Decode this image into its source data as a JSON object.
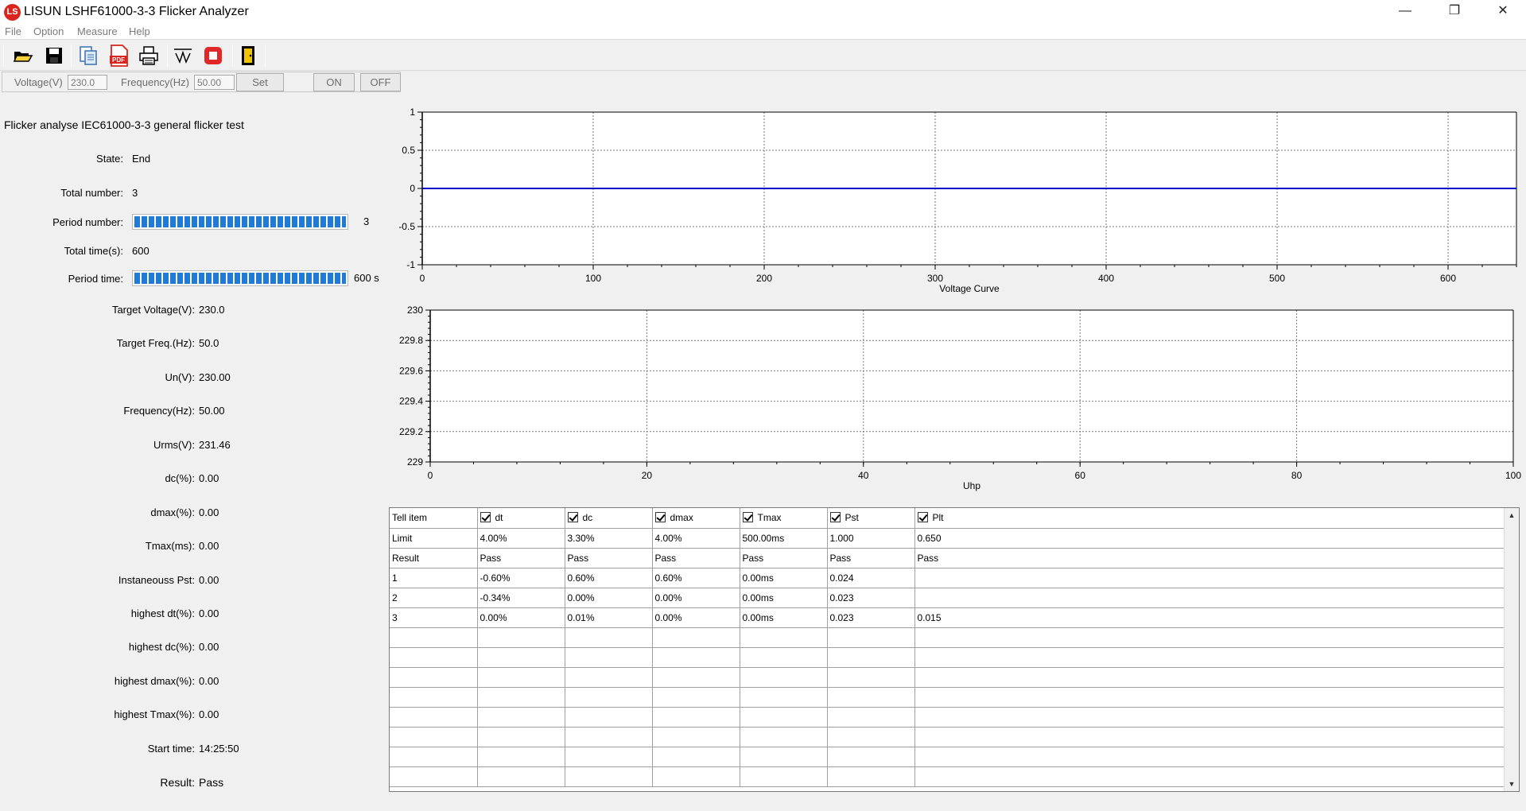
{
  "window": {
    "title": "LISUN LSHF61000-3-3 Flicker Analyzer",
    "logo_text": "LS",
    "minimize": "—",
    "restore": "❐",
    "close": "✕"
  },
  "menu": [
    "File",
    "Option",
    "Measure",
    "Help"
  ],
  "toolbar": {
    "icons": [
      "open-folder-icon",
      "save-disk-icon",
      "document-copy-icon",
      "pdf-export-icon",
      "print-icon",
      "waveform-icon",
      "stop-icon",
      "exit-door-icon"
    ],
    "pdf_label": "PDF"
  },
  "controls": {
    "voltage_label": "Voltage(V)",
    "voltage_value": "230.0",
    "frequency_label": "Frequency(Hz)",
    "frequency_value": "50.00",
    "set_label": "Set",
    "on_label": "ON",
    "off_label": "OFF"
  },
  "info": {
    "title": "Flicker analyse IEC61000-3-3 general flicker test",
    "state_label": "State:",
    "state_value": "End",
    "total_number_label": "Total number:",
    "total_number_value": "3",
    "period_number_label": "Period number:",
    "period_number_value": "3",
    "period_number_progress": 1.0,
    "total_time_label": "Total time(s):",
    "total_time_value": "600",
    "period_time_label": "Period time:",
    "period_time_value": "600 s",
    "period_time_progress": 1.0,
    "rows": [
      {
        "label": "Target Voltage(V):",
        "value": "230.0"
      },
      {
        "label": "Target Freq.(Hz):",
        "value": "50.0"
      },
      {
        "label": "Un(V):",
        "value": "230.00"
      },
      {
        "label": "Frequency(Hz):",
        "value": "50.00"
      },
      {
        "label": "Urms(V):",
        "value": "231.46"
      },
      {
        "label": "dc(%):",
        "value": "0.00"
      },
      {
        "label": "dmax(%):",
        "value": "0.00"
      },
      {
        "label": "Tmax(ms):",
        "value": "0.00"
      },
      {
        "label": "Instaneouss Pst:",
        "value": "0.00"
      },
      {
        "label": "highest dt(%):",
        "value": "0.00"
      },
      {
        "label": "highest dc(%):",
        "value": "0.00"
      },
      {
        "label": "highest dmax(%):",
        "value": "0.00"
      },
      {
        "label": "highest Tmax(%):",
        "value": "0.00"
      },
      {
        "label": "Start time:",
        "value": "14:25:50"
      },
      {
        "label": "Result:",
        "value": "Pass"
      }
    ]
  },
  "chart_data": [
    {
      "type": "line",
      "title": "",
      "xlabel": "Voltage Curve",
      "ylabel": "",
      "xlim": [
        0,
        640
      ],
      "ylim": [
        -1,
        1
      ],
      "xticks": [
        0,
        100,
        200,
        300,
        400,
        500,
        600
      ],
      "yticks": [
        1,
        0.5,
        0,
        -0.5,
        -1
      ],
      "ytick_labels": [
        "1",
        "0.5",
        "0",
        "-0.5",
        "-1"
      ],
      "grid": true,
      "series": [
        {
          "x": [
            0,
            640
          ],
          "y": [
            0,
            0
          ],
          "color": "#0000c8"
        }
      ]
    },
    {
      "type": "line",
      "title": "",
      "xlabel": "Uhp",
      "ylabel": "",
      "xlim": [
        0,
        100
      ],
      "ylim": [
        229,
        230
      ],
      "xticks": [
        0,
        20,
        40,
        60,
        80,
        100
      ],
      "yticks": [
        230,
        229.8,
        229.6,
        229.4,
        229.2,
        229
      ],
      "ytick_labels": [
        "230",
        "229.8",
        "229.6",
        "229.4",
        "229.2",
        "229"
      ],
      "grid": true,
      "series": []
    }
  ],
  "table": {
    "columns": [
      "Tell item",
      "dt",
      "dc",
      "dmax",
      "Tmax",
      "Pst",
      "Plt"
    ],
    "rows": [
      [
        "Limit",
        "4.00%",
        "3.30%",
        "4.00%",
        "500.00ms",
        "1.000",
        "0.650"
      ],
      [
        "Result",
        "Pass",
        "Pass",
        "Pass",
        "Pass",
        "Pass",
        "Pass"
      ],
      [
        "1",
        "-0.60%",
        "0.60%",
        "0.60%",
        "0.00ms",
        "0.024",
        ""
      ],
      [
        "2",
        "-0.34%",
        "0.00%",
        "0.00%",
        "0.00ms",
        "0.023",
        ""
      ],
      [
        "3",
        "0.00%",
        "0.01%",
        "0.00%",
        "0.00ms",
        "0.023",
        "0.015"
      ]
    ],
    "empty_rows": 8,
    "scroll_up": "▲",
    "scroll_down": "▼"
  }
}
